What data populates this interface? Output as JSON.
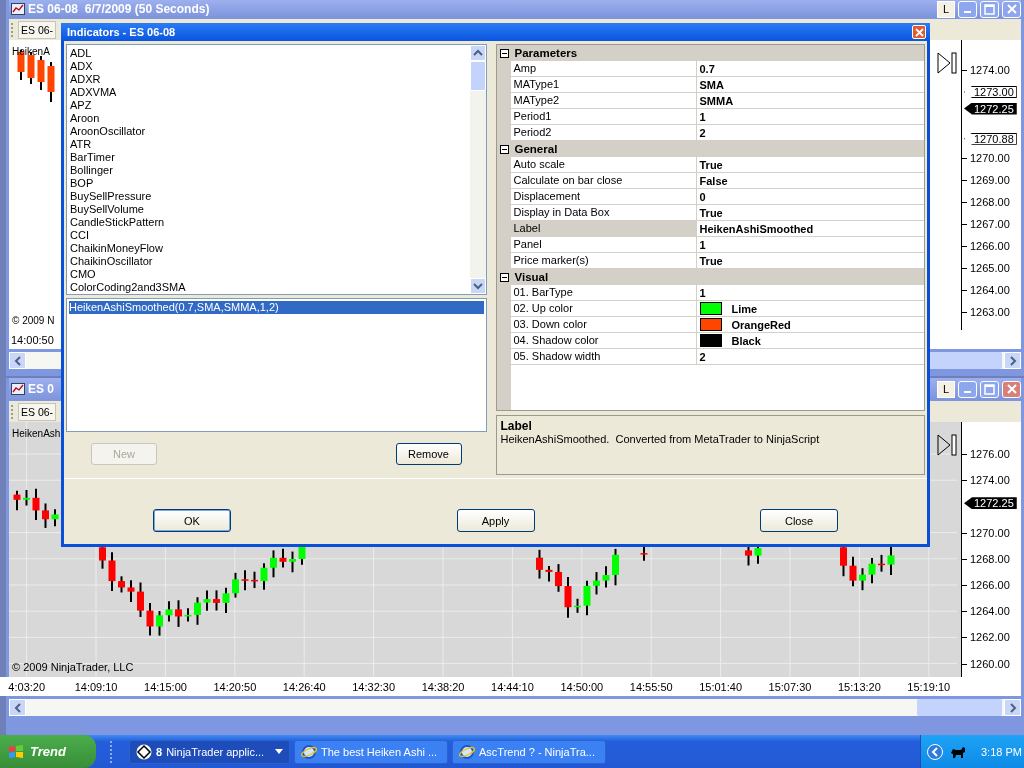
{
  "top_window": {
    "title": "ES 06-08  6/7/2009 (50 Seconds)",
    "button": "L",
    "tab": "ES 06-",
    "indicator_label": "HeikenA",
    "price_labels": [
      "1274.00",
      "1270.00",
      "1269.00",
      "1268.00",
      "1267.00",
      "1266.00",
      "1265.00",
      "1264.00",
      "1263.00"
    ],
    "price_markers": [
      {
        "label": "1273.00",
        "kind": "outline"
      },
      {
        "label": "1272.25",
        "kind": "filled"
      },
      {
        "label": "1270.88",
        "kind": "outline"
      }
    ],
    "copyright": "© 2009 N",
    "time_labels": [
      "14:00:50"
    ]
  },
  "bottom_window": {
    "title": "ES 0",
    "button": "L",
    "tab": "ES 06-",
    "indicator_label": "HeikenAsh",
    "price_labels": [
      "1276.00",
      "1274.00",
      "1270.00",
      "1268.00",
      "1266.00",
      "1264.00",
      "1262.00",
      "1260.00"
    ],
    "price_markers": [
      {
        "label": "1272.25",
        "kind": "filled"
      }
    ],
    "copyright": "© 2009 NinjaTrader, LLC",
    "time_labels": [
      "4:03:20",
      "14:09:10",
      "14:15:00",
      "14:20:50",
      "14:26:40",
      "14:32:30",
      "14:38:20",
      "14:44:10",
      "14:50:00",
      "14:55:50",
      "15:01:40",
      "15:07:30",
      "15:13:20",
      "15:19:10"
    ]
  },
  "dialog": {
    "title": "Indicators - ES 06-08",
    "available": [
      {
        "label": "ADL",
        "selected": false
      },
      {
        "label": "ADX",
        "selected": false
      },
      {
        "label": "ADXR",
        "selected": false
      },
      {
        "label": "ADXVMA",
        "selected": false
      },
      {
        "label": "APZ",
        "selected": false
      },
      {
        "label": "Aroon",
        "selected": false
      },
      {
        "label": "AroonOscillator",
        "selected": false
      },
      {
        "label": "ATR",
        "selected": false
      },
      {
        "label": "BarTimer",
        "selected": false
      },
      {
        "label": "Bollinger",
        "selected": false
      },
      {
        "label": "BOP",
        "selected": false
      },
      {
        "label": "BuySellPressure",
        "selected": false
      },
      {
        "label": "BuySellVolume",
        "selected": false
      },
      {
        "label": "CandleStickPattern",
        "selected": false
      },
      {
        "label": "CCI",
        "selected": false
      },
      {
        "label": "ChaikinMoneyFlow",
        "selected": false
      },
      {
        "label": "ChaikinOscillator",
        "selected": false
      },
      {
        "label": "CMO",
        "selected": false
      },
      {
        "label": "ColorCoding2and3SMA",
        "selected": false
      }
    ],
    "applied": [
      {
        "label": "HeikenAshiSmoothed(0.7,SMA,SMMA,1,2)",
        "selected": true
      }
    ],
    "list_buttons": [
      {
        "label": "New",
        "disabled": true
      },
      {
        "label": "Remove",
        "disabled": false
      }
    ],
    "properties": [
      {
        "category": "Parameters",
        "expanded": true,
        "rows": [
          {
            "name": "Amp",
            "value": "0.7",
            "selected": false
          },
          {
            "name": "MAType1",
            "value": "SMA",
            "selected": false
          },
          {
            "name": "MAType2",
            "value": "SMMA",
            "selected": false
          },
          {
            "name": "Period1",
            "value": "1",
            "selected": false
          },
          {
            "name": "Period2",
            "value": "2",
            "selected": false
          }
        ]
      },
      {
        "category": "General",
        "expanded": true,
        "rows": [
          {
            "name": "Auto scale",
            "value": "True",
            "selected": false
          },
          {
            "name": "Calculate on bar close",
            "value": "False",
            "selected": false
          },
          {
            "name": "Displacement",
            "value": "0",
            "selected": false
          },
          {
            "name": "Display in Data Box",
            "value": "True",
            "selected": false
          },
          {
            "name": "Label",
            "value": "HeikenAshiSmoothed",
            "selected": true
          },
          {
            "name": "Panel",
            "value": "1",
            "selected": false
          },
          {
            "name": "Price marker(s)",
            "value": "True",
            "selected": false
          }
        ]
      },
      {
        "category": "Visual",
        "expanded": true,
        "rows": [
          {
            "name": "01. BarType",
            "value": "1",
            "selected": false
          },
          {
            "name": "02. Up color",
            "value": "Lime",
            "color": "#00ff00",
            "selected": false
          },
          {
            "name": "03. Down color",
            "value": "OrangeRed",
            "color": "#ff4500",
            "selected": false
          },
          {
            "name": "04. Shadow color",
            "value": "Black",
            "color": "#000000",
            "selected": false
          },
          {
            "name": "05. Shadow width",
            "value": "2",
            "selected": false
          }
        ]
      }
    ],
    "description": {
      "title": "Label",
      "text": "HeikenAshiSmoothed.  Converted from MetaTrader to NinjaScript"
    },
    "buttons": [
      "OK",
      "Apply",
      "Close"
    ]
  },
  "taskbar": {
    "start": "Trend",
    "tasks": [
      {
        "kind": "group",
        "badge": "8",
        "label": "NinjaTrader applic...",
        "selected": true
      },
      {
        "kind": "browser",
        "label": "The best Heiken Ashi ...",
        "selected": false
      },
      {
        "kind": "browser",
        "label": "AscTrend ? - NinjaTra...",
        "selected": false
      }
    ],
    "clock": "3:18 PM"
  }
}
